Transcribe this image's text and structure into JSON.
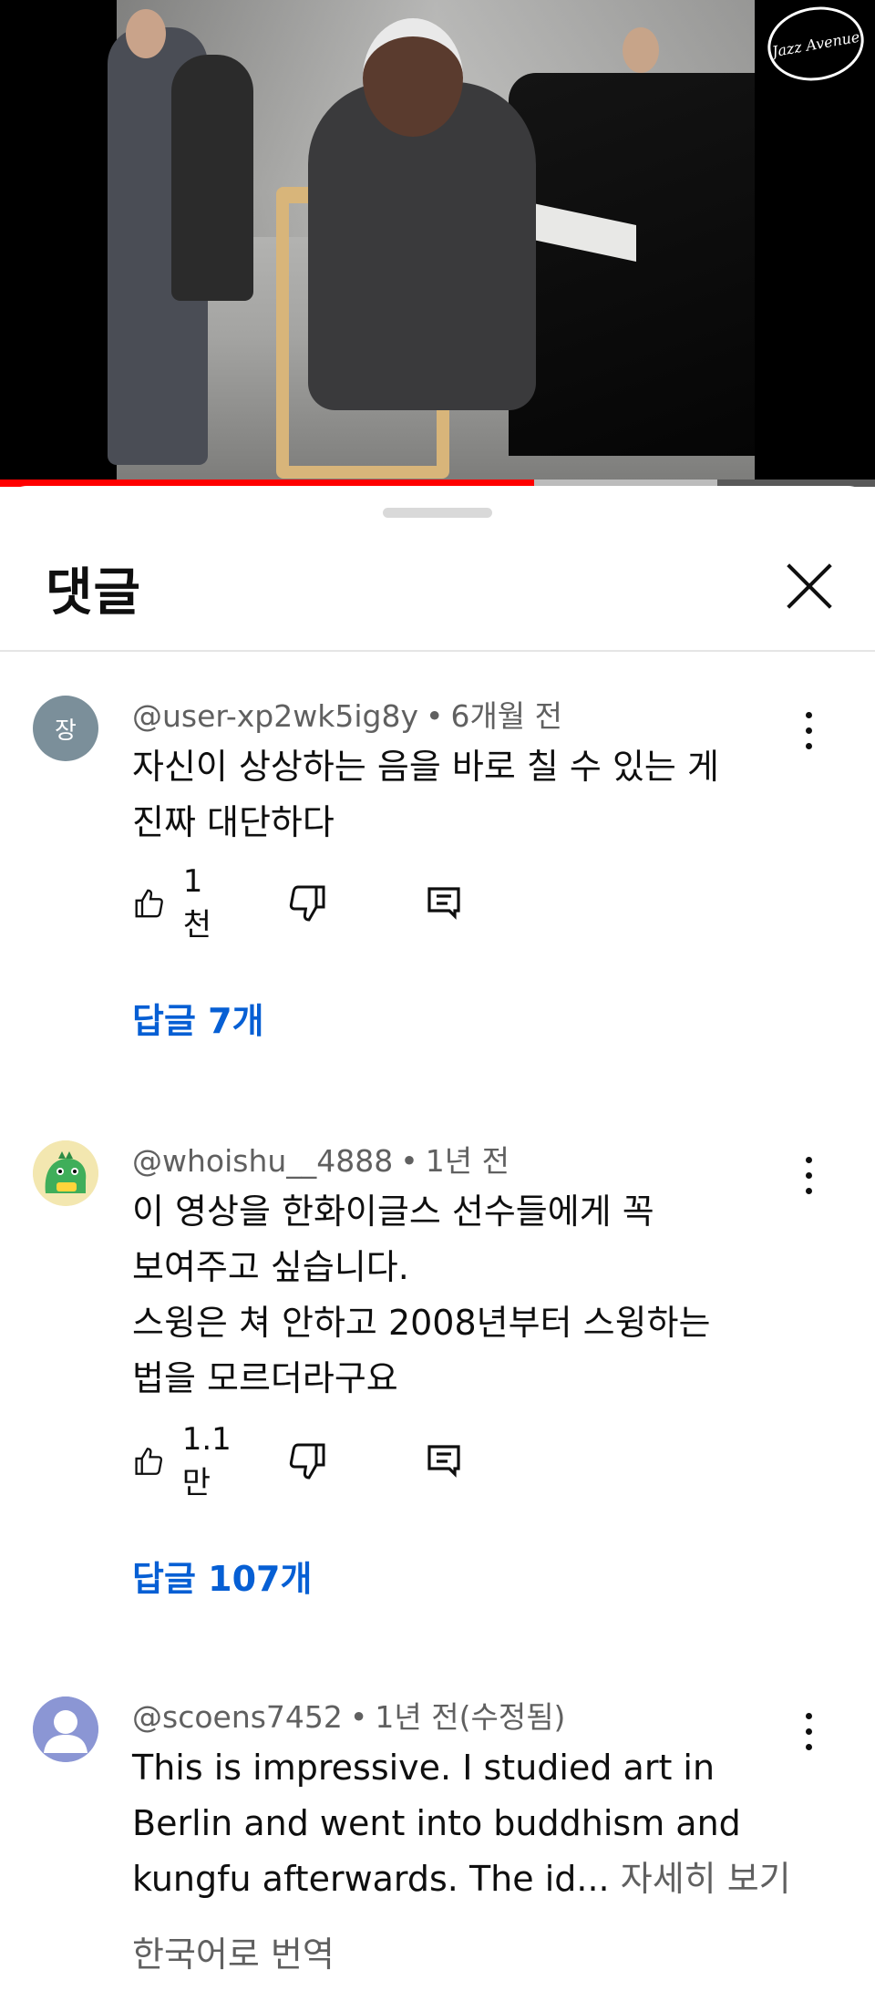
{
  "video": {
    "logo_text": "Jazz Avenue",
    "progress_fraction": 0.61,
    "buffer_fraction": 0.82
  },
  "sheet": {
    "title": "댓글"
  },
  "comments": [
    {
      "avatar_letter": "장",
      "avatar_color": "#7b8f9a",
      "author": "@user-xp2wk5ig8y",
      "time": "6개월 전",
      "lines": [
        "자신이 상상하는 음을 바로 칠 수 있는 게",
        "진짜 대단하다"
      ],
      "likes": "1천",
      "replies": "답글 7개"
    },
    {
      "avatar_letter": "",
      "avatar_color": "#f3e7b0",
      "author": "@whoishu__4888",
      "time": "1년 전",
      "lines": [
        "이 영상을 한화이글스 선수들에게 꼭",
        "보여주고 싶습니다.",
        "스윙은 쳐 안하고 2008년부터 스윙하는",
        "법을 모르더라구요"
      ],
      "likes": "1.1만",
      "replies": "답글 107개"
    },
    {
      "avatar_letter": "",
      "avatar_color": "#8b96d4",
      "author": "@scoens7452",
      "time": "1년 전(수정됨)",
      "lines": [
        "This is impressive. I studied art in",
        "Berlin and went into buddhism and",
        "kungfu afterwards. The id..."
      ],
      "read_more": "자세히 보기",
      "translate": "한국어로 번역"
    }
  ],
  "separator": "•",
  "icons": {
    "like": "thumb-up-icon",
    "dislike": "thumb-down-icon",
    "reply": "comment-icon",
    "more": "more-vert-icon",
    "close": "close-icon"
  },
  "colors": {
    "link_blue": "#065fd4",
    "progress_red": "#ff0000",
    "secondary_text": "#606060"
  }
}
